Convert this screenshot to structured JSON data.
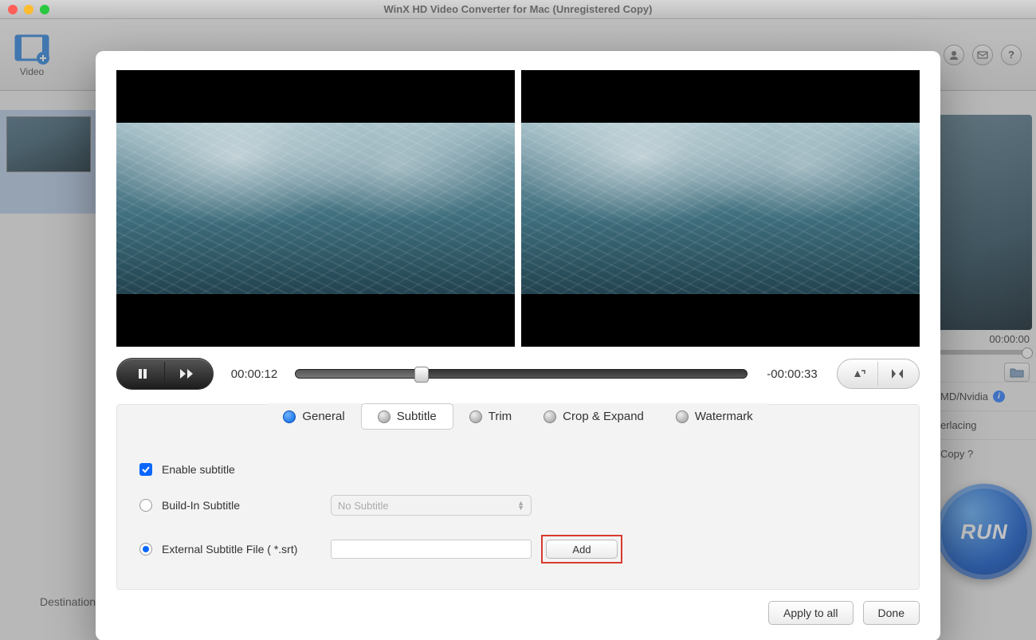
{
  "titlebar": {
    "title": "WinX HD Video Converter for Mac (Unregistered Copy)"
  },
  "toolbar": {
    "video_label": "Video"
  },
  "right": {
    "timecode": "00:00:00",
    "opt_gpu": "MD/Nvidia",
    "opt_deint": "erlacing",
    "opt_copy": "Copy ?",
    "run": "RUN"
  },
  "dest_label": "Destination",
  "player": {
    "current_time": "00:00:12",
    "remaining_time": "-00:00:33"
  },
  "tabs": {
    "general": "General",
    "subtitle": "Subtitle",
    "trim": "Trim",
    "crop": "Crop & Expand",
    "watermark": "Watermark"
  },
  "subtitle_panel": {
    "enable": "Enable subtitle",
    "builtin": "Build-In Subtitle",
    "builtin_select": "No Subtitle",
    "external": "External Subtitle File ( *.srt)",
    "add": "Add"
  },
  "footer": {
    "apply_all": "Apply to all",
    "done": "Done"
  }
}
